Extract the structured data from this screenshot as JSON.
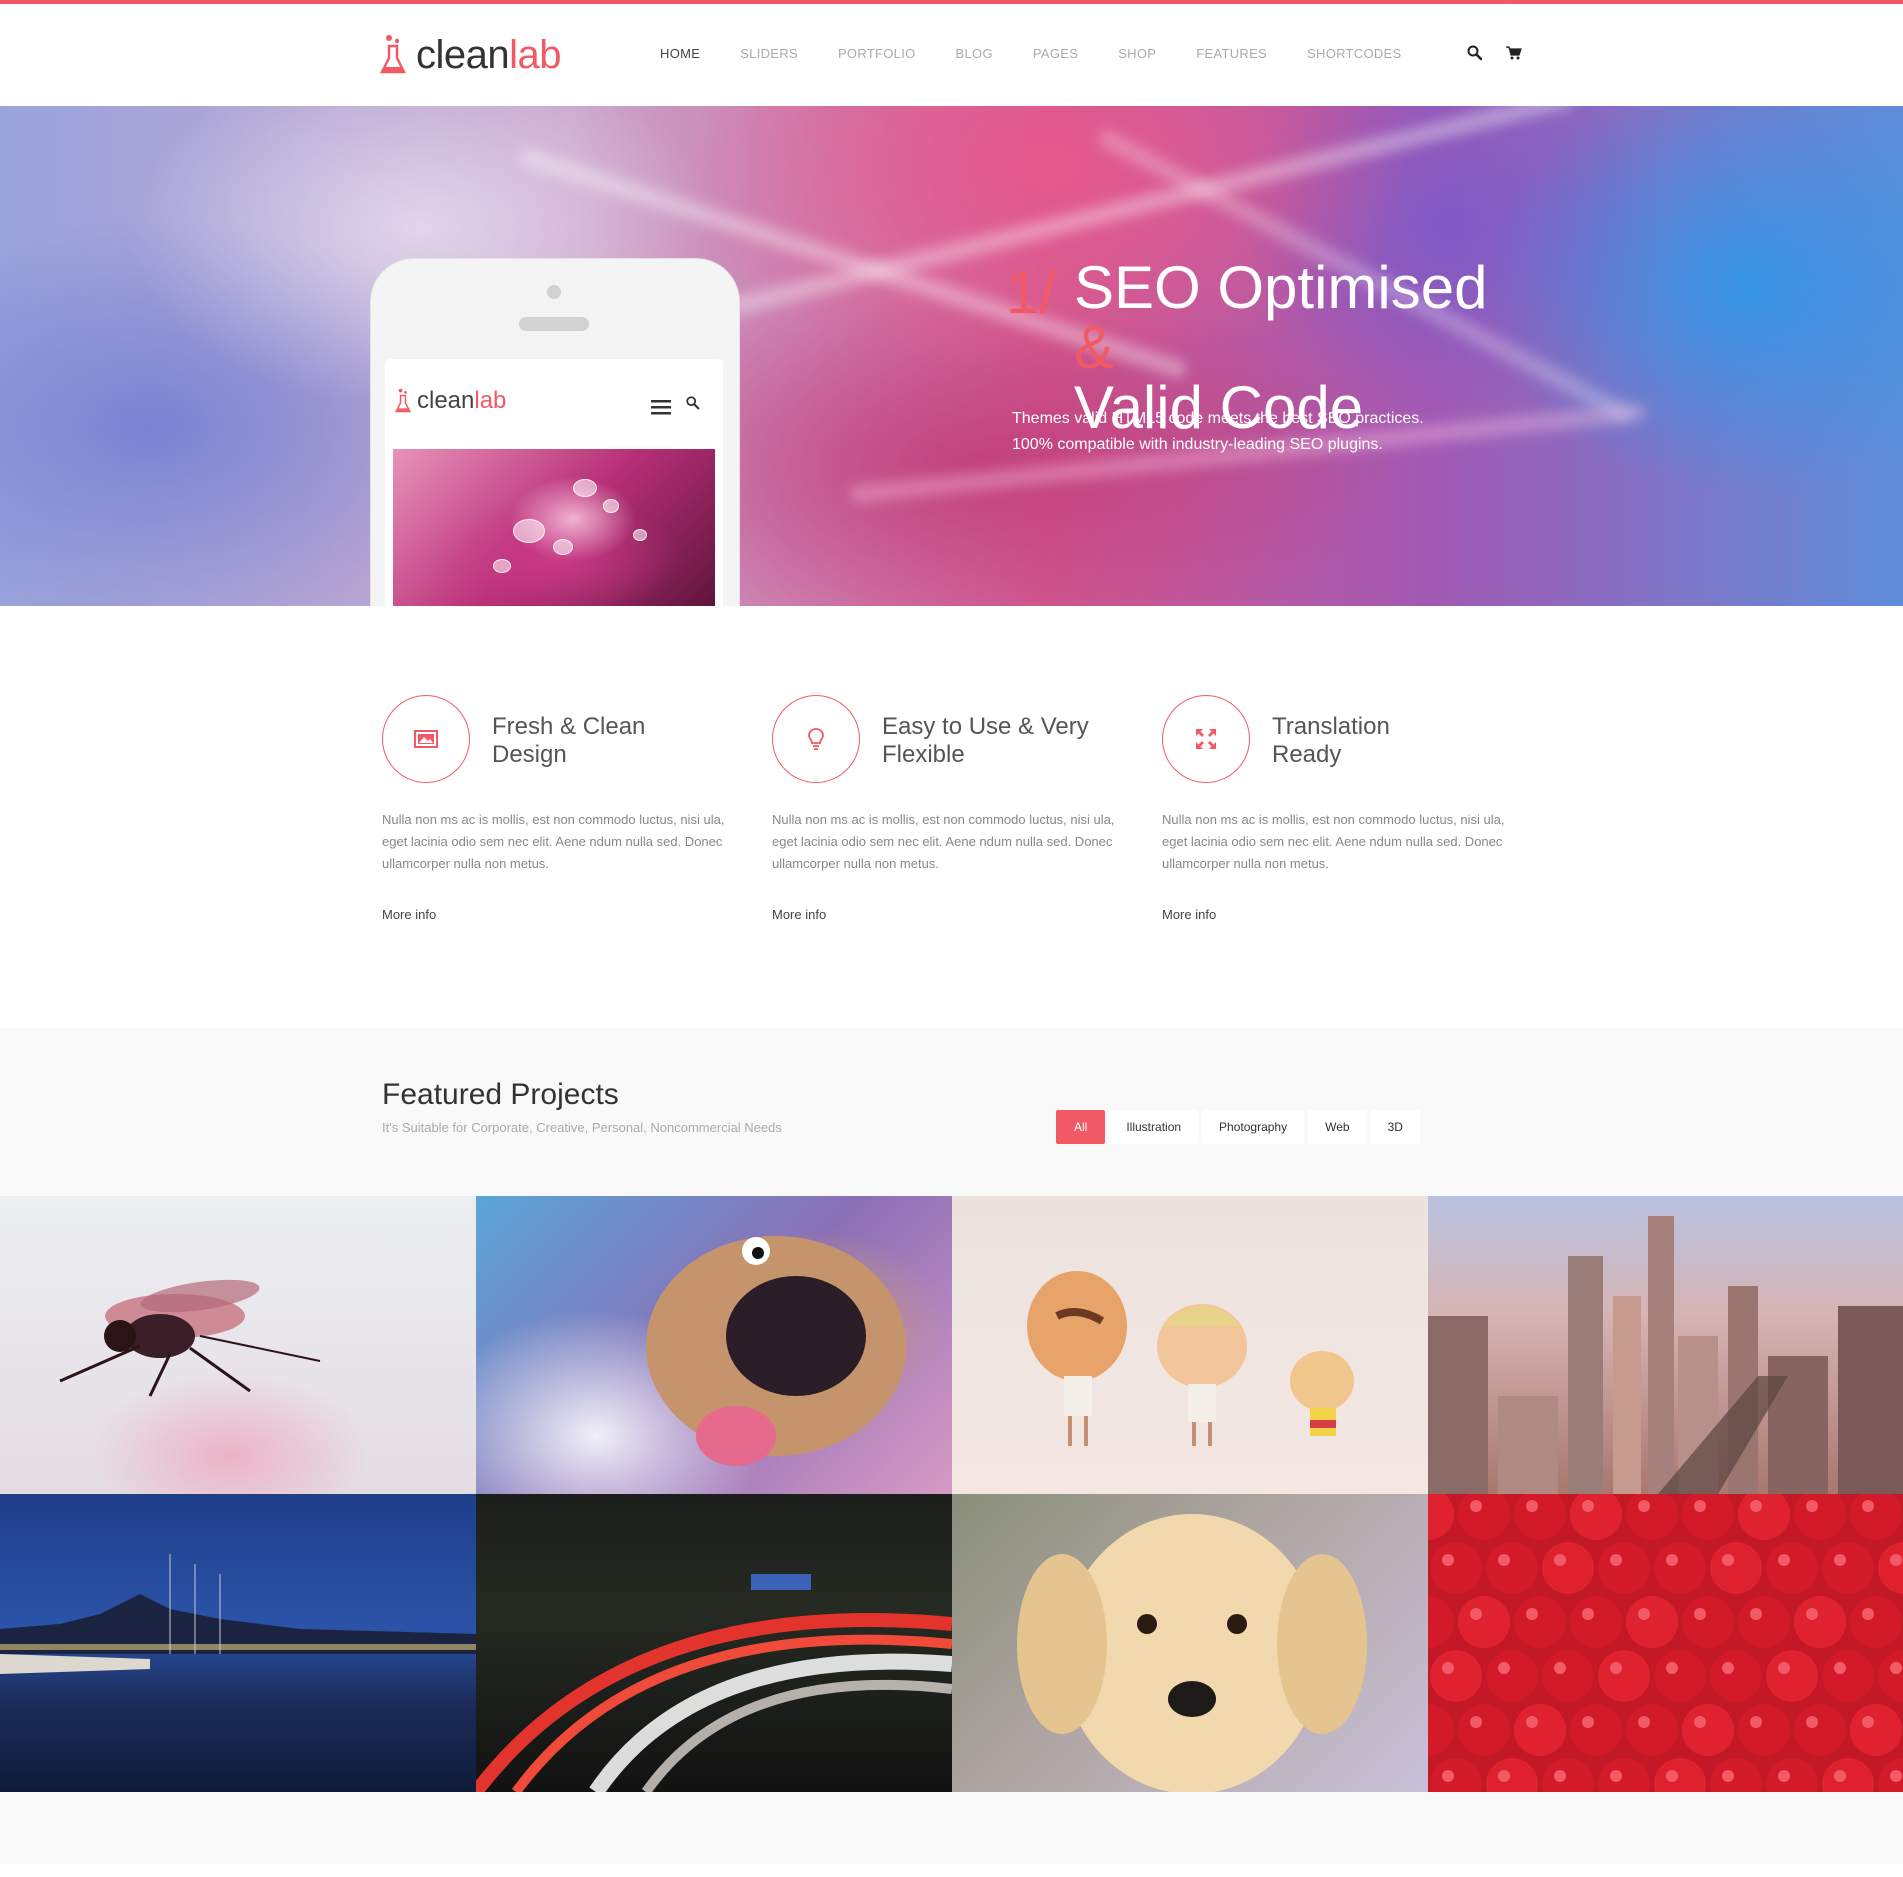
{
  "brand": {
    "name_a": "clean",
    "name_b": "lab",
    "accent": "#f15a65"
  },
  "nav": {
    "items": [
      "HOME",
      "SLIDERS",
      "PORTFOLIO",
      "BLOG",
      "PAGES",
      "SHOP",
      "FEATURES",
      "SHORTCODES"
    ],
    "active": "HOME"
  },
  "header_icons": [
    "search-icon",
    "cart-icon"
  ],
  "hero": {
    "number": "1/",
    "title_line1": "SEO Optimised",
    "title_amp": "&",
    "title_line2": "Valid Code",
    "sub_line1": "Themes valid HTML5 code meets the best SEO practices.",
    "sub_line2": "100% compatible with industry-leading SEO plugins."
  },
  "features": [
    {
      "icon": "image-icon",
      "title_line1": "Fresh & Clean",
      "title_line2": "Design",
      "text": "Nulla non ms ac is mollis, est non commodo luctus, nisi ula, eget lacinia odio sem nec elit. Aene ndum nulla sed. Donec ullamcorper nulla non metus.",
      "more": "More info"
    },
    {
      "icon": "lightbulb-icon",
      "title_line1": "Easy to Use & Very",
      "title_line2": "Flexible",
      "text": "Nulla non ms ac is mollis, est non commodo luctus, nisi ula, eget lacinia odio sem nec elit. Aene ndum nulla sed. Donec ullamcorper nulla non metus.",
      "more": "More info"
    },
    {
      "icon": "expand-icon",
      "title_line1": "Translation",
      "title_line2": "Ready",
      "text": "Nulla non ms ac is mollis, est non commodo luctus, nisi ula, eget lacinia odio sem nec elit. Aene ndum nulla sed. Donec ullamcorper nulla non metus.",
      "more": "More info"
    }
  ],
  "projects": {
    "title": "Featured Projects",
    "subtitle": "It's Suitable for Corporate, Creative, Personal, Noncommercial Needs",
    "filters": [
      "All",
      "Illustration",
      "Photography",
      "Web",
      "3D"
    ],
    "active_filter": "All"
  }
}
